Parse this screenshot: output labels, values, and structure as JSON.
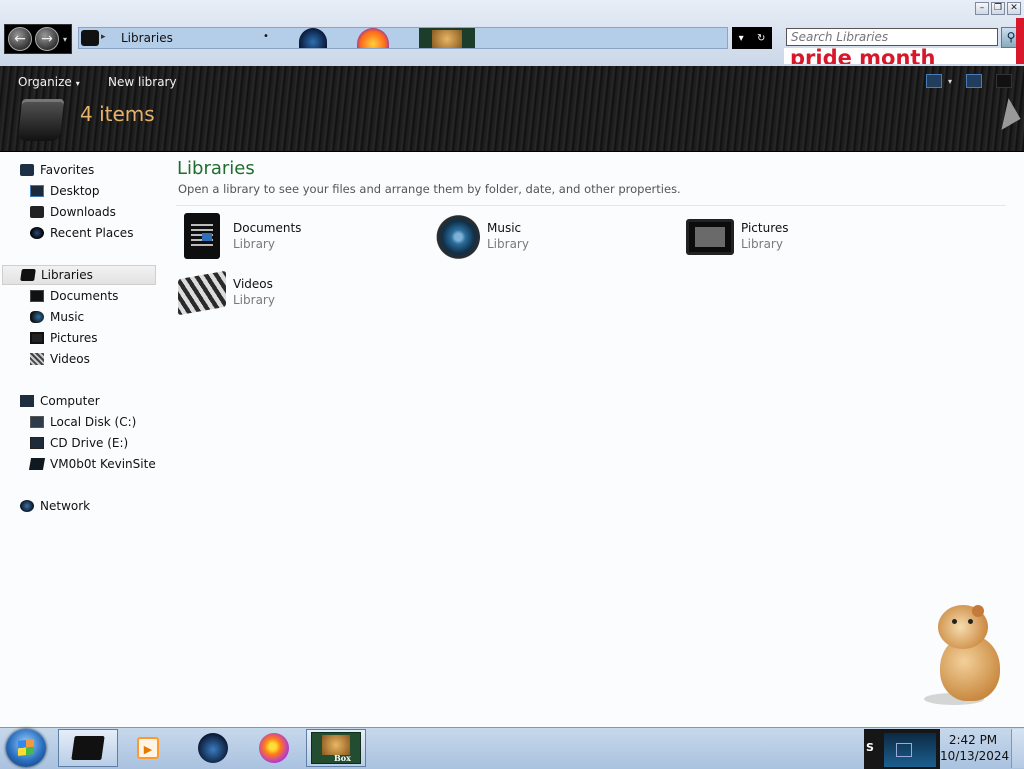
{
  "window": {
    "controls": {
      "minimize": "–",
      "restore": "❐",
      "close": "✕"
    }
  },
  "nav": {
    "back_glyph": "←",
    "forward_glyph": "→",
    "dropdown_glyph": "▾"
  },
  "address": {
    "separator": "▸",
    "crumb": "Libraries",
    "overflow_glyph": "•",
    "refresh_glyph": "↻",
    "dropdown_glyph": "▾"
  },
  "search": {
    "placeholder": "Search Libraries",
    "button_glyph": "⚲"
  },
  "banner": {
    "text": "pride month"
  },
  "command_bar": {
    "organize": "Organize",
    "new_library": "New library",
    "caret": "▾",
    "item_count": "4 items"
  },
  "sidebar": {
    "favorites": {
      "label": "Favorites",
      "items": [
        {
          "label": "Desktop",
          "icon": "desktop-icon"
        },
        {
          "label": "Downloads",
          "icon": "downloads-icon"
        },
        {
          "label": "Recent Places",
          "icon": "recent-places-icon"
        }
      ]
    },
    "libraries": {
      "label": "Libraries",
      "items": [
        {
          "label": "Documents",
          "icon": "documents-icon"
        },
        {
          "label": "Music",
          "icon": "music-icon"
        },
        {
          "label": "Pictures",
          "icon": "pictures-icon"
        },
        {
          "label": "Videos",
          "icon": "videos-icon"
        }
      ]
    },
    "computer": {
      "label": "Computer",
      "items": [
        {
          "label": "Local Disk (C:)",
          "icon": "disk-icon"
        },
        {
          "label": "CD Drive (E:)",
          "icon": "cd-drive-icon"
        },
        {
          "label": "VM0b0t KevinSite",
          "icon": "network-drive-icon"
        }
      ]
    },
    "network": {
      "label": "Network"
    }
  },
  "content": {
    "title": "Libraries",
    "subtitle": "Open a library to see your files and arrange them by folder, date, and other properties.",
    "items": [
      {
        "name": "Documents",
        "type": "Library"
      },
      {
        "name": "Music",
        "type": "Library"
      },
      {
        "name": "Pictures",
        "type": "Library"
      },
      {
        "name": "Videos",
        "type": "Library"
      }
    ]
  },
  "taskbar": {
    "box_label": "Box",
    "tray_label": "S",
    "time": "2:42 PM",
    "date": "10/13/2024"
  },
  "colors": {
    "library_heading": "#1e6e2e",
    "item_count": "#e9b26a",
    "banner_red": "#d8182a"
  }
}
